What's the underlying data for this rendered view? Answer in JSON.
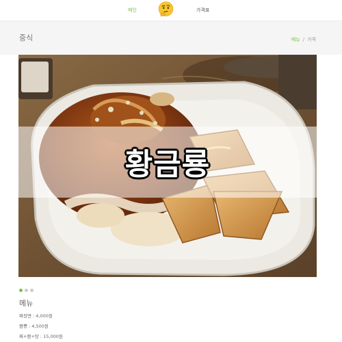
{
  "nav": {
    "left_label": "메인",
    "right_label": "가격표",
    "logo_icon": "thinking-face-icon"
  },
  "header": {
    "title": "중식",
    "breadcrumb": [
      "메뉴",
      "가격"
    ]
  },
  "hero": {
    "title": "황금룡",
    "slide_count": 3,
    "active_slide": 1
  },
  "menu": {
    "heading": "메뉴",
    "items": [
      "짜장면 : 4,000원",
      "짬뽕 : 4,500원",
      "짜+짬+탕 : 15,000원"
    ]
  },
  "colors": {
    "accent": "#7cc242",
    "header_band": "#f5f5f5"
  }
}
